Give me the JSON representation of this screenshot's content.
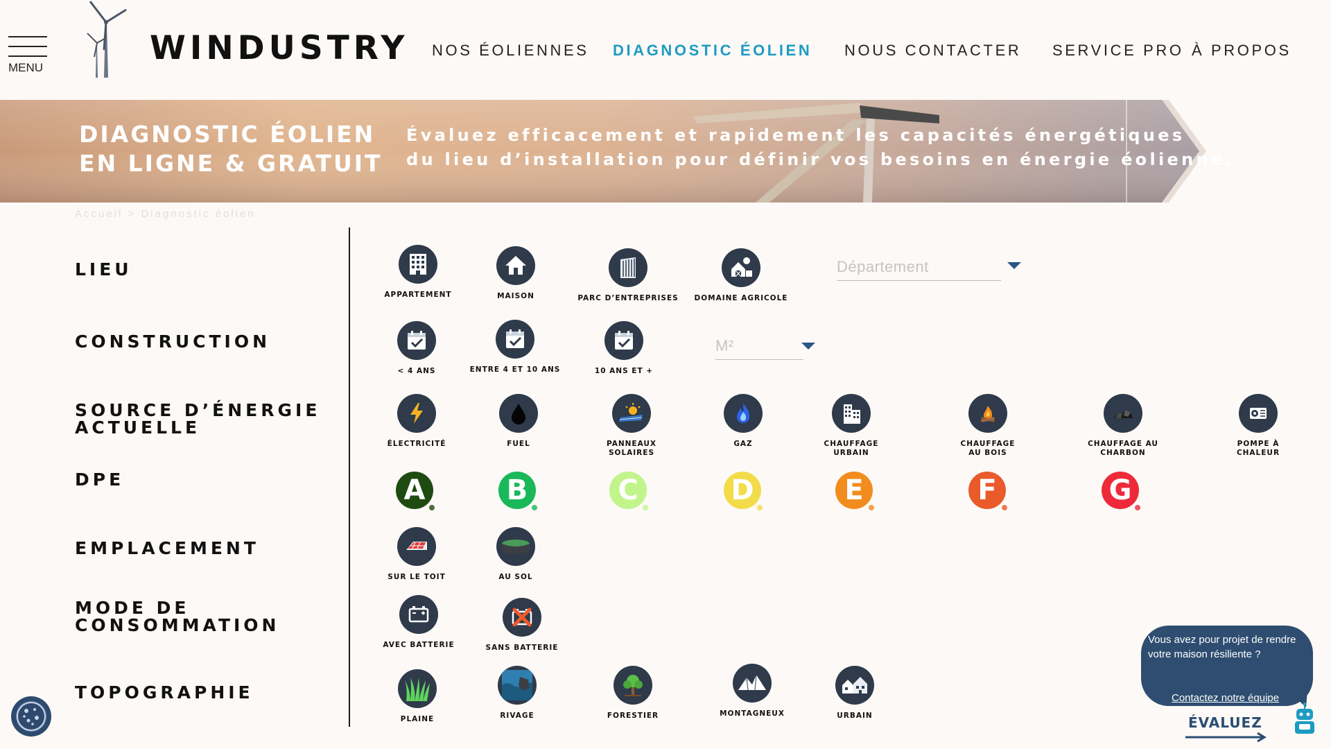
{
  "header": {
    "menu_label": "MENU",
    "brand": "WINDUSTRY",
    "nav": [
      {
        "label": "NOS ÉOLIENNES",
        "active": false
      },
      {
        "label": "DIAGNOSTIC ÉOLIEN",
        "active": true
      },
      {
        "label": "NOUS CONTACTER",
        "active": false
      },
      {
        "label": "SERVICE PRO",
        "active": false
      },
      {
        "label": "À PROPOS",
        "active": false
      }
    ]
  },
  "banner": {
    "title_line1": "DIAGNOSTIC ÉOLIEN",
    "title_line2": "EN LIGNE & GRATUIT",
    "subtitle_line1": "Évaluez efficacement et rapidement les capacités énergétiques",
    "subtitle_line2": "du lieu d’installation pour définir vos besoins en énergie éolienne."
  },
  "breadcrumb": "Accueil > Diagnostic éolien",
  "sections": {
    "lieu": "LIEU",
    "construction": "CONSTRUCTION",
    "source_line1": "SOURCE D’ÉNERGIE",
    "source_line2": "ACTUELLE",
    "dpe": "DPE",
    "emplacement": "EMPLACEMENT",
    "mode_line1": "MODE DE",
    "mode_line2": "CONSOMMATION",
    "topographie": "TOPOGRAPHIE"
  },
  "lieu": {
    "options": [
      "APPARTEMENT",
      "MAISON",
      "PARC D’ENTREPRISES",
      "DOMAINE AGRICOLE"
    ],
    "departement_placeholder": "Département"
  },
  "construction": {
    "options": [
      "< 4 ANS",
      "ENTRE 4 ET 10 ANS",
      "10 ANS ET +"
    ],
    "surface_placeholder": "M²"
  },
  "source": {
    "options": [
      {
        "line1": "ÉLECTRICITÉ",
        "line2": ""
      },
      {
        "line1": "FUEL",
        "line2": ""
      },
      {
        "line1": "PANNEAUX",
        "line2": "SOLAIRES"
      },
      {
        "line1": "GAZ",
        "line2": ""
      },
      {
        "line1": "CHAUFFAGE",
        "line2": "URBAIN"
      },
      {
        "line1": "CHAUFFAGE",
        "line2": "AU BOIS"
      },
      {
        "line1": "CHAUFFAGE AU",
        "line2": "CHARBON"
      },
      {
        "line1": "POMPE À",
        "line2": "CHALEUR"
      }
    ]
  },
  "dpe": {
    "grades": [
      {
        "letter": "A",
        "color": "#1f4a12"
      },
      {
        "letter": "B",
        "color": "#1ab85a"
      },
      {
        "letter": "C",
        "color": "#c2f48c"
      },
      {
        "letter": "D",
        "color": "#f2dc4a"
      },
      {
        "letter": "E",
        "color": "#f28c1e"
      },
      {
        "letter": "F",
        "color": "#ea5a2a"
      },
      {
        "letter": "G",
        "color": "#ee2a3a"
      }
    ]
  },
  "emplacement": {
    "options": [
      "SUR LE TOIT",
      "AU SOL"
    ]
  },
  "mode": {
    "options": [
      "AVEC BATTERIE",
      "SANS BATTERIE"
    ]
  },
  "topographie": {
    "options": [
      "PLAINE",
      "RIVAGE",
      "FORESTIER",
      "MONTAGNEUX",
      "URBAIN"
    ]
  },
  "contact": {
    "text": "Vous avez pour projet de rendre votre maison résiliente ?",
    "link": "Contactez notre équipe",
    "cta": "ÉVALUEZ"
  },
  "icons": {
    "logo": "wind-turbine-icon",
    "cookie": "cookie-icon",
    "robot": "robot-assistant-icon"
  }
}
